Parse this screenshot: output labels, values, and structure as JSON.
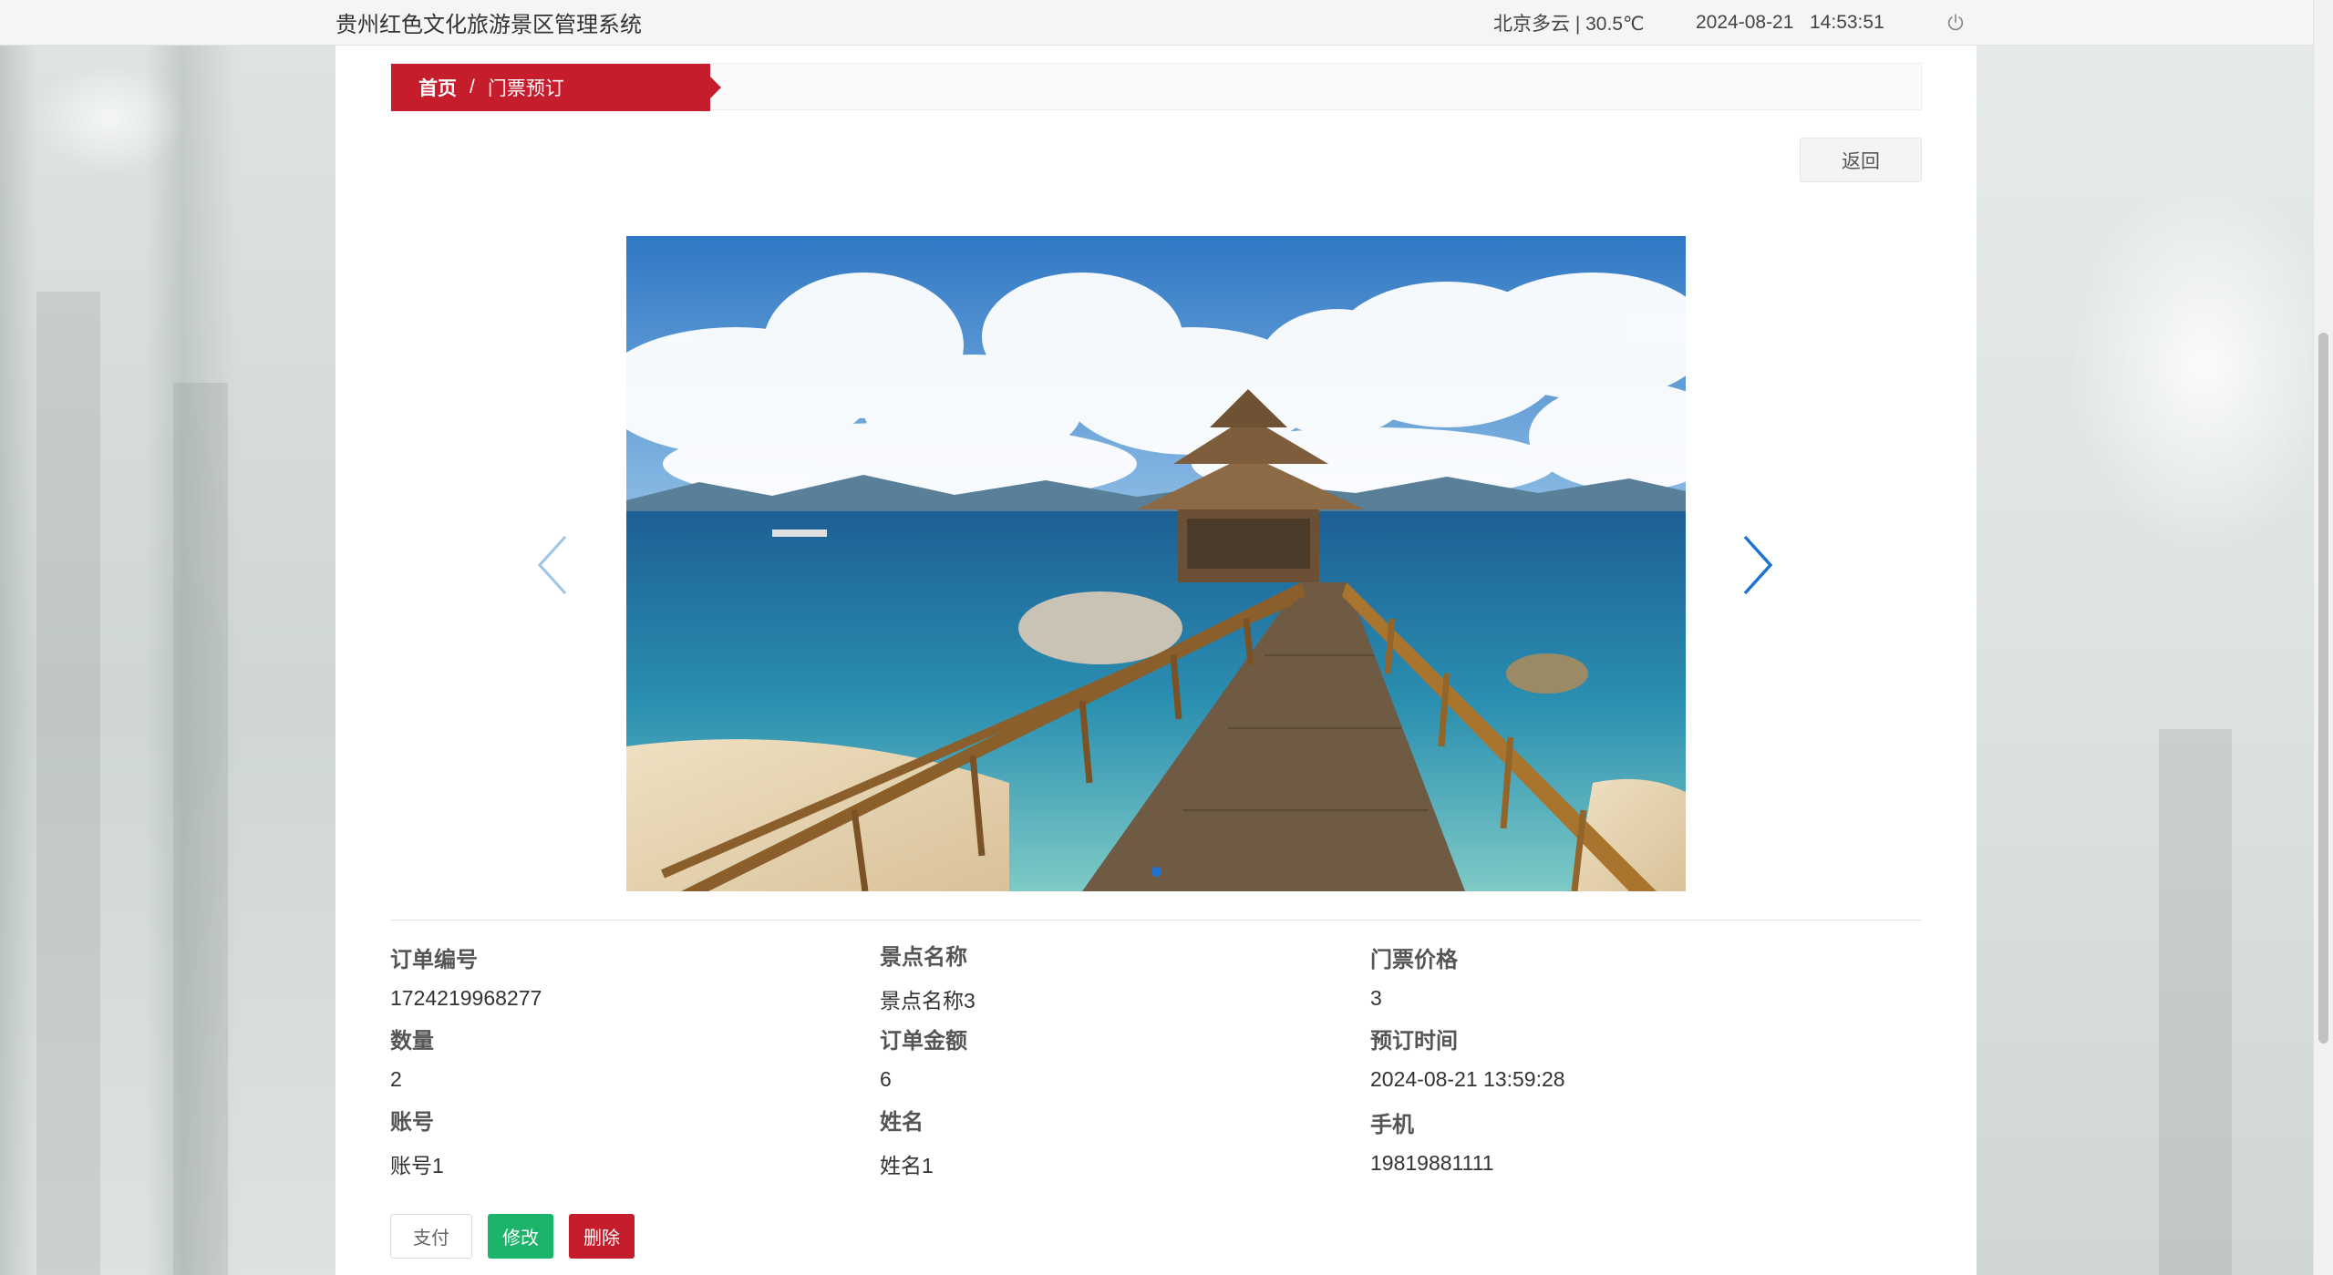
{
  "header": {
    "system_title": "贵州红色文化旅游景区管理系统",
    "weather": "北京多云 | 30.5℃",
    "date": "2024-08-21",
    "time": "14:53:51",
    "power_icon": "power-icon"
  },
  "breadcrumb": {
    "home": "首页",
    "separator": "/",
    "current": "门票预订"
  },
  "toolbar": {
    "back_label": "返回"
  },
  "carousel": {
    "prev_icon": "chevron-left-icon",
    "next_icon": "chevron-right-icon",
    "slide_count": 1,
    "active_index": 0
  },
  "details": {
    "order_no": {
      "label": "订单编号",
      "value": "1724219968277"
    },
    "spot_name": {
      "label": "景点名称",
      "value": "景点名称3"
    },
    "ticket_price": {
      "label": "门票价格",
      "value": "3"
    },
    "quantity": {
      "label": "数量",
      "value": "2"
    },
    "order_amount": {
      "label": "订单金额",
      "value": "6"
    },
    "booking_time": {
      "label": "预订时间",
      "value": "2024-08-21 13:59:28"
    },
    "account": {
      "label": "账号",
      "value": "账号1"
    },
    "name": {
      "label": "姓名",
      "value": "姓名1"
    },
    "phone": {
      "label": "手机",
      "value": "19819881111"
    }
  },
  "actions": {
    "pay_label": "支付",
    "edit_label": "修改",
    "delete_label": "删除"
  },
  "colors": {
    "accent_red": "#c61d2d",
    "edit_green": "#1cb36a",
    "carousel_blue": "#1e73d2"
  }
}
